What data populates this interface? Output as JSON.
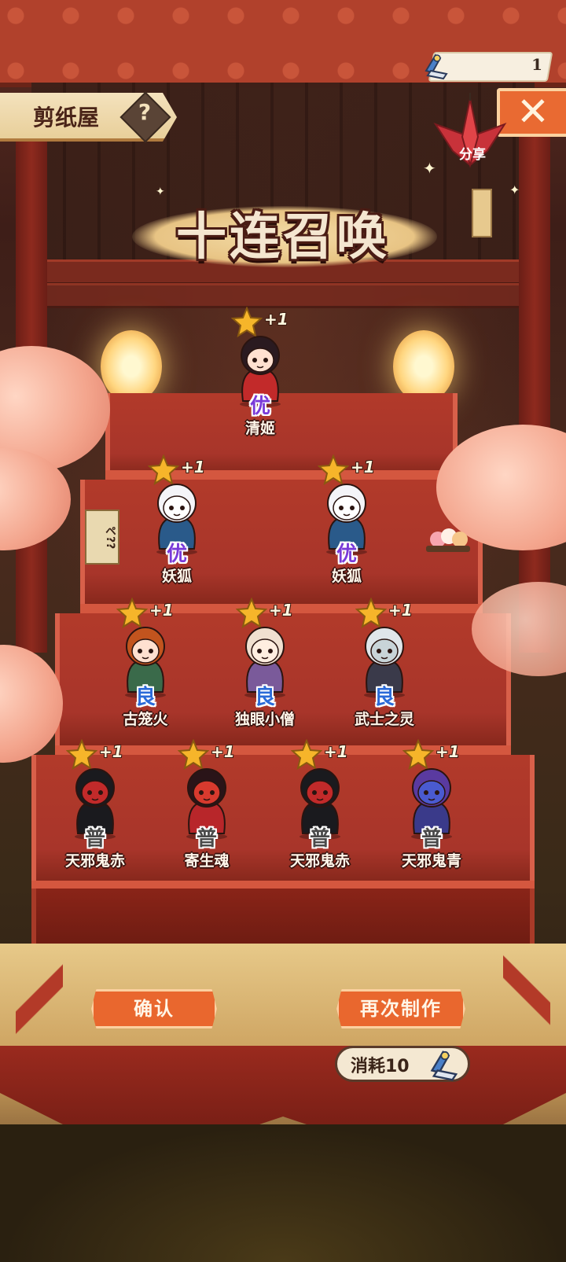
{
  "header": {
    "shop_name": "剪纸屋",
    "help_glyph": "?",
    "ticket_count": "1",
    "share_label": "分享",
    "close_glyph": "✕"
  },
  "title": "十连召唤",
  "side_sign": "ペ??",
  "characters": [
    {
      "name": "清姬",
      "grade": "优",
      "bonus": "+1",
      "grade_color": "#7a3ad8",
      "body": "#c22a2a",
      "hair": "#2a1a20",
      "skin": "#ffe0d0"
    },
    {
      "name": "妖狐",
      "grade": "优",
      "bonus": "+1",
      "grade_color": "#7a3ad8",
      "body": "#2a5a8a",
      "hair": "#f4f4f8",
      "skin": "#ffffff"
    },
    {
      "name": "妖狐",
      "grade": "优",
      "bonus": "+1",
      "grade_color": "#7a3ad8",
      "body": "#2a5a8a",
      "hair": "#f4f4f8",
      "skin": "#ffffff"
    },
    {
      "name": "古笼火",
      "grade": "良",
      "bonus": "+1",
      "grade_color": "#2a6ad8",
      "body": "#3a6a4a",
      "hair": "#c2541e",
      "skin": "#ffe0d0"
    },
    {
      "name": "独眼小僧",
      "grade": "良",
      "bonus": "+1",
      "grade_color": "#2a6ad8",
      "body": "#7a5a9a",
      "hair": "#f0e0d0",
      "skin": "#ffeee0"
    },
    {
      "name": "武士之灵",
      "grade": "良",
      "bonus": "+1",
      "grade_color": "#2a6ad8",
      "body": "#3a3a4a",
      "hair": "#dfe6ea",
      "skin": "#c8d4d8"
    },
    {
      "name": "天邪鬼赤",
      "grade": "普",
      "bonus": "+1",
      "grade_color": "#4a4a4a",
      "body": "#1a1a1e",
      "hair": "#1a1a1e",
      "skin": "#c22a2a"
    },
    {
      "name": "寄生魂",
      "grade": "普",
      "bonus": "+1",
      "grade_color": "#4a4a4a",
      "body": "#b8262a",
      "hair": "#2a1418",
      "skin": "#d83a2e"
    },
    {
      "name": "天邪鬼赤",
      "grade": "普",
      "bonus": "+1",
      "grade_color": "#4a4a4a",
      "body": "#1a1a1e",
      "hair": "#1a1a1e",
      "skin": "#c22a2a"
    },
    {
      "name": "天邪鬼青",
      "grade": "普",
      "bonus": "+1",
      "grade_color": "#4a4a4a",
      "body": "#3a3a8a",
      "hair": "#5a3aa0",
      "skin": "#4a5ad0"
    }
  ],
  "buttons": {
    "confirm": "确认",
    "again": "再次制作",
    "cost": "消耗10"
  },
  "colors": {
    "accent": "#e9672e",
    "stair_red": "#b23a2a",
    "star": "#f6b52a"
  }
}
